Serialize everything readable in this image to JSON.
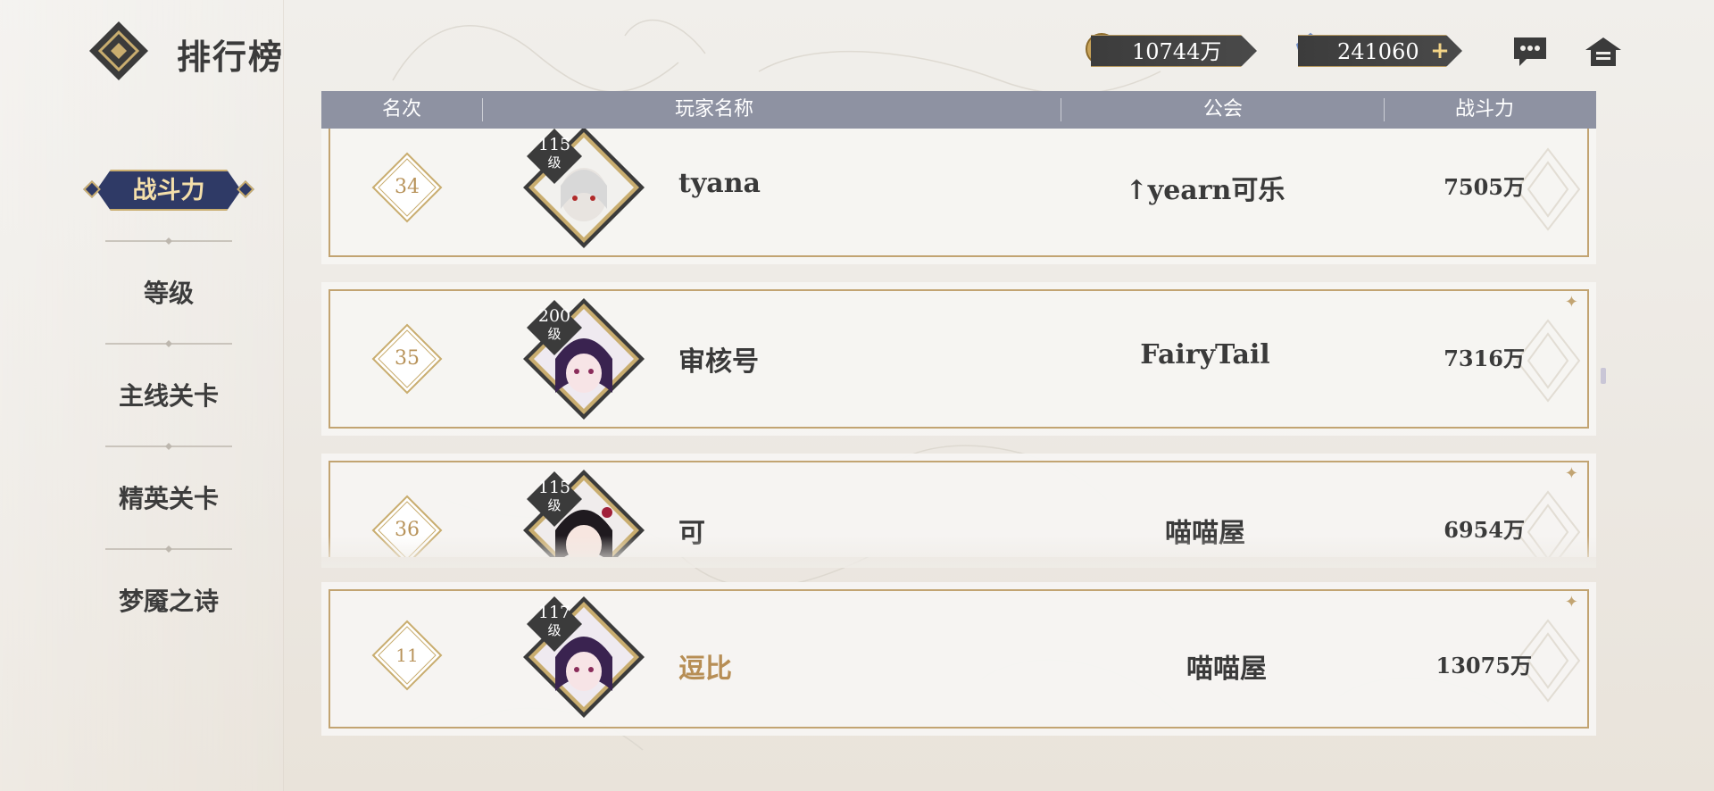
{
  "header": {
    "title": "排行榜",
    "gold_amount": "10744万",
    "gem_amount": "241060",
    "add_symbol": "+"
  },
  "sidebar": {
    "tabs": [
      {
        "label": "战斗力",
        "active": true
      },
      {
        "label": "等级",
        "active": false
      },
      {
        "label": "主线关卡",
        "active": false
      },
      {
        "label": "精英关卡",
        "active": false
      },
      {
        "label": "梦魇之诗",
        "active": false
      }
    ]
  },
  "table": {
    "columns": [
      "名次",
      "玩家名称",
      "公会",
      "战斗力"
    ],
    "rows": [
      {
        "rank": "34",
        "level": "115",
        "level_unit": "级",
        "name": "tyana",
        "guild": "↑yearn可乐",
        "power": "7505万"
      },
      {
        "rank": "35",
        "level": "200",
        "level_unit": "级",
        "name": "审核号",
        "guild": "FairyTail",
        "power": "7316万"
      },
      {
        "rank": "36",
        "level": "115",
        "level_unit": "级",
        "name": "可",
        "guild": "喵喵屋",
        "power": "6954万"
      }
    ],
    "self_row": {
      "rank": "11",
      "level": "117",
      "level_unit": "级",
      "name": "逗比",
      "guild": "喵喵屋",
      "power": "13075万"
    }
  },
  "colors": {
    "header_bar": "#8e92a2",
    "gold_frame": "#c2a472",
    "active_tab": "#2f3a66",
    "self_name": "#b78e55"
  },
  "icons": [
    "app-logo-icon",
    "gold-coin-icon",
    "gem-icon",
    "chat-icon",
    "home-icon"
  ]
}
